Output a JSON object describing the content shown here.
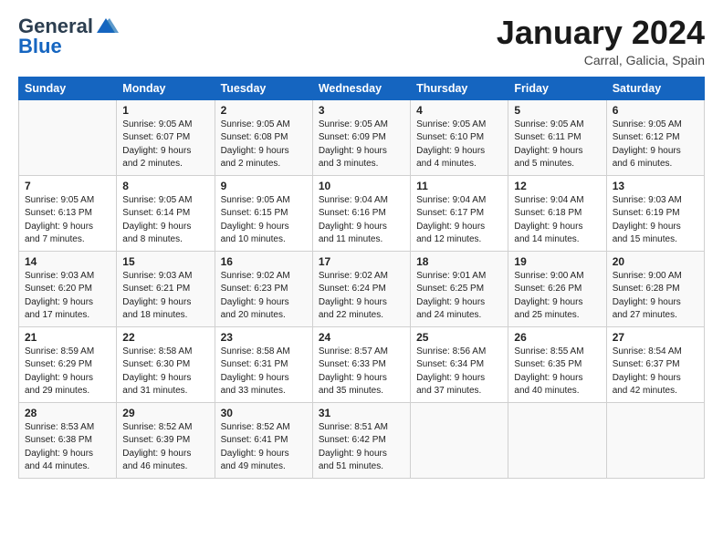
{
  "header": {
    "logo_general": "General",
    "logo_blue": "Blue",
    "month_title": "January 2024",
    "location": "Carral, Galicia, Spain"
  },
  "days": [
    "Sunday",
    "Monday",
    "Tuesday",
    "Wednesday",
    "Thursday",
    "Friday",
    "Saturday"
  ],
  "weeks": [
    [
      {
        "date": "",
        "sunrise": "",
        "sunset": "",
        "daylight": ""
      },
      {
        "date": "1",
        "sunrise": "Sunrise: 9:05 AM",
        "sunset": "Sunset: 6:07 PM",
        "daylight": "Daylight: 9 hours and 2 minutes."
      },
      {
        "date": "2",
        "sunrise": "Sunrise: 9:05 AM",
        "sunset": "Sunset: 6:08 PM",
        "daylight": "Daylight: 9 hours and 2 minutes."
      },
      {
        "date": "3",
        "sunrise": "Sunrise: 9:05 AM",
        "sunset": "Sunset: 6:09 PM",
        "daylight": "Daylight: 9 hours and 3 minutes."
      },
      {
        "date": "4",
        "sunrise": "Sunrise: 9:05 AM",
        "sunset": "Sunset: 6:10 PM",
        "daylight": "Daylight: 9 hours and 4 minutes."
      },
      {
        "date": "5",
        "sunrise": "Sunrise: 9:05 AM",
        "sunset": "Sunset: 6:11 PM",
        "daylight": "Daylight: 9 hours and 5 minutes."
      },
      {
        "date": "6",
        "sunrise": "Sunrise: 9:05 AM",
        "sunset": "Sunset: 6:12 PM",
        "daylight": "Daylight: 9 hours and 6 minutes."
      }
    ],
    [
      {
        "date": "7",
        "sunrise": "Sunrise: 9:05 AM",
        "sunset": "Sunset: 6:13 PM",
        "daylight": "Daylight: 9 hours and 7 minutes."
      },
      {
        "date": "8",
        "sunrise": "Sunrise: 9:05 AM",
        "sunset": "Sunset: 6:14 PM",
        "daylight": "Daylight: 9 hours and 8 minutes."
      },
      {
        "date": "9",
        "sunrise": "Sunrise: 9:05 AM",
        "sunset": "Sunset: 6:15 PM",
        "daylight": "Daylight: 9 hours and 10 minutes."
      },
      {
        "date": "10",
        "sunrise": "Sunrise: 9:04 AM",
        "sunset": "Sunset: 6:16 PM",
        "daylight": "Daylight: 9 hours and 11 minutes."
      },
      {
        "date": "11",
        "sunrise": "Sunrise: 9:04 AM",
        "sunset": "Sunset: 6:17 PM",
        "daylight": "Daylight: 9 hours and 12 minutes."
      },
      {
        "date": "12",
        "sunrise": "Sunrise: 9:04 AM",
        "sunset": "Sunset: 6:18 PM",
        "daylight": "Daylight: 9 hours and 14 minutes."
      },
      {
        "date": "13",
        "sunrise": "Sunrise: 9:03 AM",
        "sunset": "Sunset: 6:19 PM",
        "daylight": "Daylight: 9 hours and 15 minutes."
      }
    ],
    [
      {
        "date": "14",
        "sunrise": "Sunrise: 9:03 AM",
        "sunset": "Sunset: 6:20 PM",
        "daylight": "Daylight: 9 hours and 17 minutes."
      },
      {
        "date": "15",
        "sunrise": "Sunrise: 9:03 AM",
        "sunset": "Sunset: 6:21 PM",
        "daylight": "Daylight: 9 hours and 18 minutes."
      },
      {
        "date": "16",
        "sunrise": "Sunrise: 9:02 AM",
        "sunset": "Sunset: 6:23 PM",
        "daylight": "Daylight: 9 hours and 20 minutes."
      },
      {
        "date": "17",
        "sunrise": "Sunrise: 9:02 AM",
        "sunset": "Sunset: 6:24 PM",
        "daylight": "Daylight: 9 hours and 22 minutes."
      },
      {
        "date": "18",
        "sunrise": "Sunrise: 9:01 AM",
        "sunset": "Sunset: 6:25 PM",
        "daylight": "Daylight: 9 hours and 24 minutes."
      },
      {
        "date": "19",
        "sunrise": "Sunrise: 9:00 AM",
        "sunset": "Sunset: 6:26 PM",
        "daylight": "Daylight: 9 hours and 25 minutes."
      },
      {
        "date": "20",
        "sunrise": "Sunrise: 9:00 AM",
        "sunset": "Sunset: 6:28 PM",
        "daylight": "Daylight: 9 hours and 27 minutes."
      }
    ],
    [
      {
        "date": "21",
        "sunrise": "Sunrise: 8:59 AM",
        "sunset": "Sunset: 6:29 PM",
        "daylight": "Daylight: 9 hours and 29 minutes."
      },
      {
        "date": "22",
        "sunrise": "Sunrise: 8:58 AM",
        "sunset": "Sunset: 6:30 PM",
        "daylight": "Daylight: 9 hours and 31 minutes."
      },
      {
        "date": "23",
        "sunrise": "Sunrise: 8:58 AM",
        "sunset": "Sunset: 6:31 PM",
        "daylight": "Daylight: 9 hours and 33 minutes."
      },
      {
        "date": "24",
        "sunrise": "Sunrise: 8:57 AM",
        "sunset": "Sunset: 6:33 PM",
        "daylight": "Daylight: 9 hours and 35 minutes."
      },
      {
        "date": "25",
        "sunrise": "Sunrise: 8:56 AM",
        "sunset": "Sunset: 6:34 PM",
        "daylight": "Daylight: 9 hours and 37 minutes."
      },
      {
        "date": "26",
        "sunrise": "Sunrise: 8:55 AM",
        "sunset": "Sunset: 6:35 PM",
        "daylight": "Daylight: 9 hours and 40 minutes."
      },
      {
        "date": "27",
        "sunrise": "Sunrise: 8:54 AM",
        "sunset": "Sunset: 6:37 PM",
        "daylight": "Daylight: 9 hours and 42 minutes."
      }
    ],
    [
      {
        "date": "28",
        "sunrise": "Sunrise: 8:53 AM",
        "sunset": "Sunset: 6:38 PM",
        "daylight": "Daylight: 9 hours and 44 minutes."
      },
      {
        "date": "29",
        "sunrise": "Sunrise: 8:52 AM",
        "sunset": "Sunset: 6:39 PM",
        "daylight": "Daylight: 9 hours and 46 minutes."
      },
      {
        "date": "30",
        "sunrise": "Sunrise: 8:52 AM",
        "sunset": "Sunset: 6:41 PM",
        "daylight": "Daylight: 9 hours and 49 minutes."
      },
      {
        "date": "31",
        "sunrise": "Sunrise: 8:51 AM",
        "sunset": "Sunset: 6:42 PM",
        "daylight": "Daylight: 9 hours and 51 minutes."
      },
      {
        "date": "",
        "sunrise": "",
        "sunset": "",
        "daylight": ""
      },
      {
        "date": "",
        "sunrise": "",
        "sunset": "",
        "daylight": ""
      },
      {
        "date": "",
        "sunrise": "",
        "sunset": "",
        "daylight": ""
      }
    ]
  ]
}
